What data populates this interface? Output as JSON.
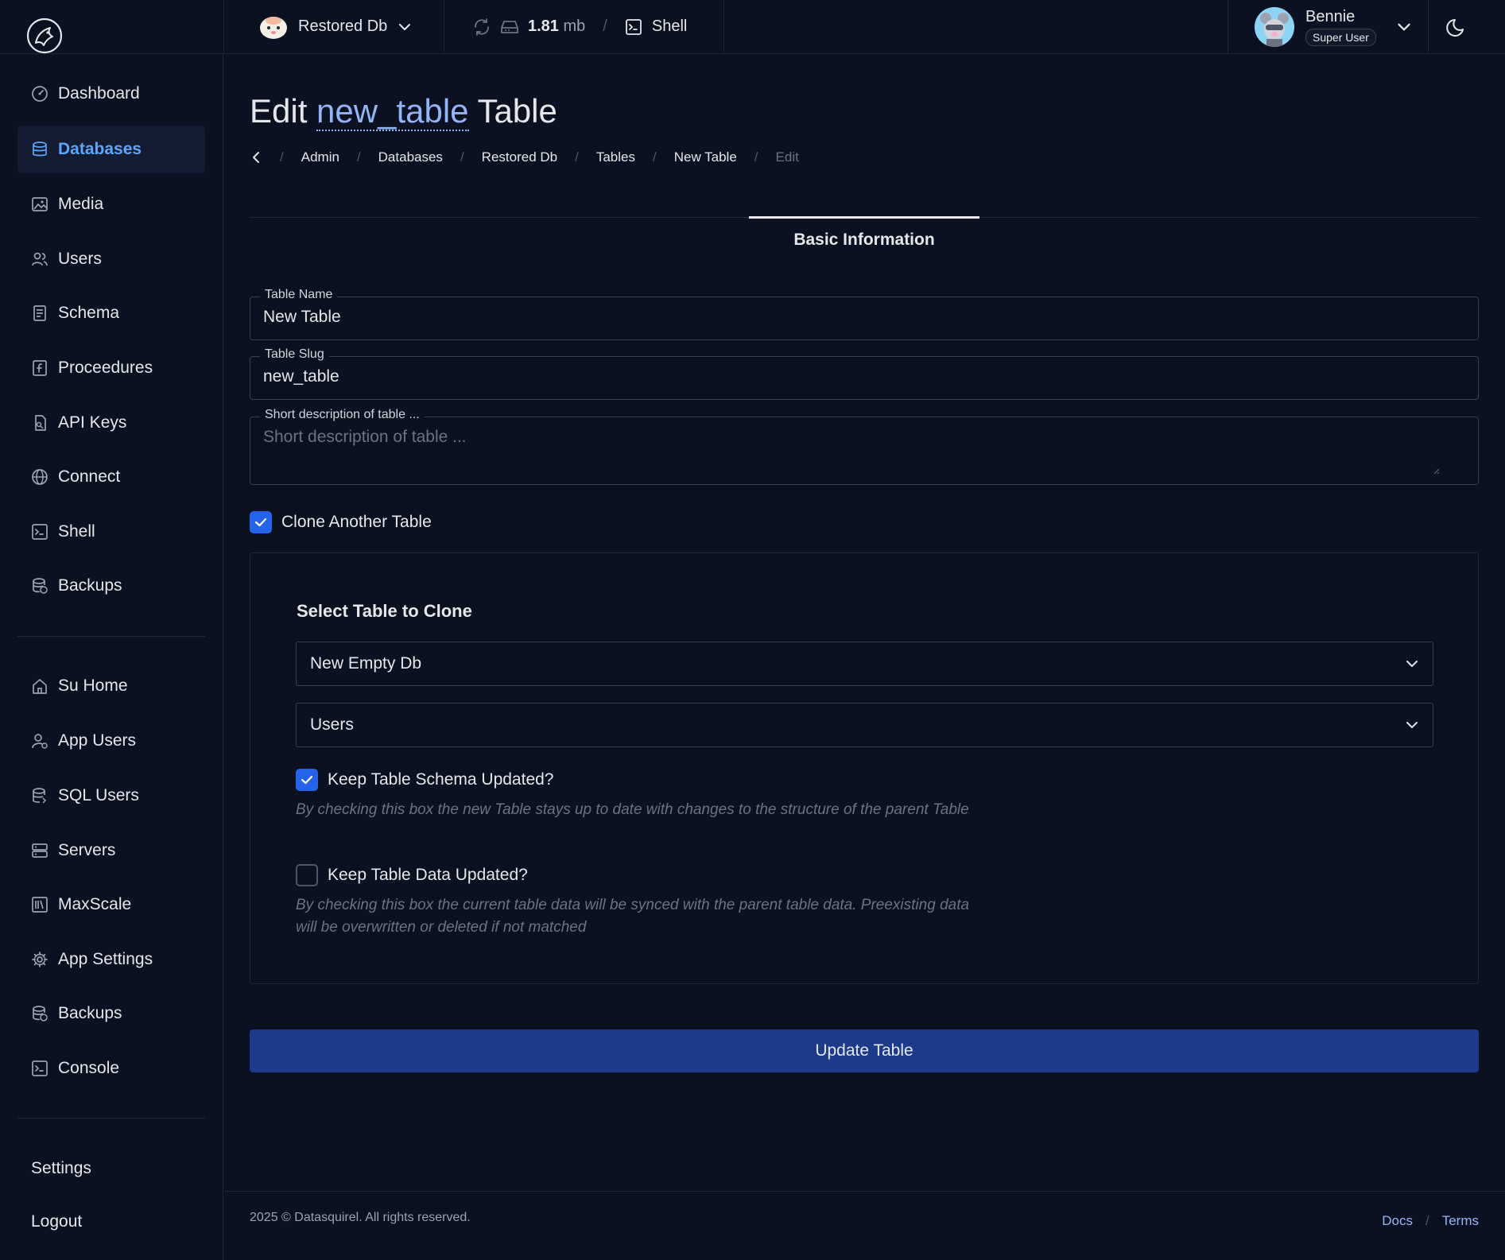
{
  "topbar": {
    "database_name": "Restored Db",
    "db_size_value": "1.81",
    "db_size_unit": "mb",
    "shell_label": "Shell",
    "user_name": "Bennie",
    "user_role": "Super User"
  },
  "sidebar": {
    "primary": [
      {
        "label": "Dashboard",
        "icon": "dashboard-icon",
        "active": false
      },
      {
        "label": "Databases",
        "icon": "database-icon",
        "active": true
      },
      {
        "label": "Media",
        "icon": "image-icon",
        "active": false
      },
      {
        "label": "Users",
        "icon": "users-icon",
        "active": false
      },
      {
        "label": "Schema",
        "icon": "schema-icon",
        "active": false
      },
      {
        "label": "Proceedures",
        "icon": "function-icon",
        "active": false
      },
      {
        "label": "API Keys",
        "icon": "key-icon",
        "active": false
      },
      {
        "label": "Connect",
        "icon": "globe-icon",
        "active": false
      },
      {
        "label": "Shell",
        "icon": "terminal-icon",
        "active": false
      },
      {
        "label": "Backups",
        "icon": "backup-icon",
        "active": false
      }
    ],
    "admin": [
      {
        "label": "Su Home",
        "icon": "home-icon"
      },
      {
        "label": "App Users",
        "icon": "user-cog-icon"
      },
      {
        "label": "SQL Users",
        "icon": "database-user-icon"
      },
      {
        "label": "Servers",
        "icon": "server-icon"
      },
      {
        "label": "MaxScale",
        "icon": "library-icon"
      },
      {
        "label": "App Settings",
        "icon": "gear-icon"
      },
      {
        "label": "Backups",
        "icon": "backup-icon"
      },
      {
        "label": "Console",
        "icon": "terminal-icon"
      }
    ],
    "settings_label": "Settings",
    "logout_label": "Logout"
  },
  "page": {
    "title_prefix": "Edit",
    "title_slug": "new_table",
    "title_suffix": "Table",
    "breadcrumb": [
      "Admin",
      "Databases",
      "Restored Db",
      "Tables",
      "New Table",
      "Edit"
    ]
  },
  "tabs": {
    "active": "Basic Information"
  },
  "form": {
    "table_name_label": "Table Name",
    "table_name_value": "New Table",
    "table_slug_label": "Table Slug",
    "table_slug_value": "new_table",
    "description_label": "Short description of table ...",
    "description_placeholder": "Short description of table ...",
    "clone_label": "Clone Another Table",
    "clone_checked": true
  },
  "clone": {
    "title": "Select Table to Clone",
    "database_select": "New Empty Db",
    "table_select": "Users",
    "keep_schema_label": "Keep Table Schema Updated?",
    "keep_schema_checked": true,
    "keep_schema_help": "By checking this box the new Table stays up to date with changes to the structure of the parent Table",
    "keep_data_label": "Keep Table Data Updated?",
    "keep_data_checked": false,
    "keep_data_help": "By checking this box the current table data will be synced with the parent table data. Preexisting data will be overwritten or deleted if not matched"
  },
  "submit_label": "Update Table",
  "footer": {
    "copyright": "2025 © Datasquirel. All rights reserved.",
    "docs_label": "Docs",
    "terms_label": "Terms"
  },
  "colors": {
    "background": "#0b1120",
    "accent": "#60a5fa",
    "primary_button": "#1e3a8a",
    "checkbox": "#2563eb"
  }
}
